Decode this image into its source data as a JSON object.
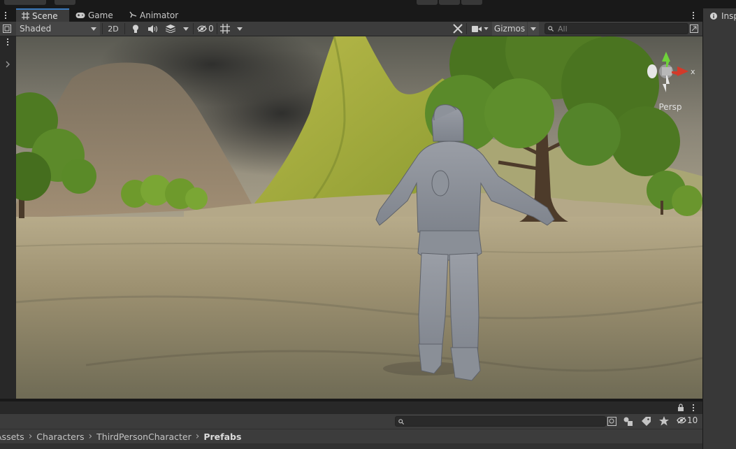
{
  "tabs": [
    {
      "label": "Scene",
      "icon": "grid-icon",
      "active": true
    },
    {
      "label": "Game",
      "icon": "gamepad-icon",
      "active": false
    },
    {
      "label": "Animator",
      "icon": "animator-icon",
      "active": false
    }
  ],
  "inspector_tab": {
    "label": "Insp",
    "icon": "info-icon"
  },
  "toolbar": {
    "shading_mode": "Shaded",
    "mode_2d": "2D",
    "hidden_count": "0",
    "gizmos_label": "Gizmos",
    "search_placeholder": "All"
  },
  "viewport": {
    "projection_label": "Persp",
    "axis_x_label": "x"
  },
  "project": {
    "hidden_count": "10",
    "breadcrumb": [
      "Assets",
      "Characters",
      "ThirdPersonCharacter",
      "Prefabs"
    ]
  },
  "colors": {
    "accent_tab": "#3a79bb",
    "panel": "#3c3c3c",
    "gizmo_x": "#d23a2a",
    "gizmo_y": "#6fd23a"
  }
}
